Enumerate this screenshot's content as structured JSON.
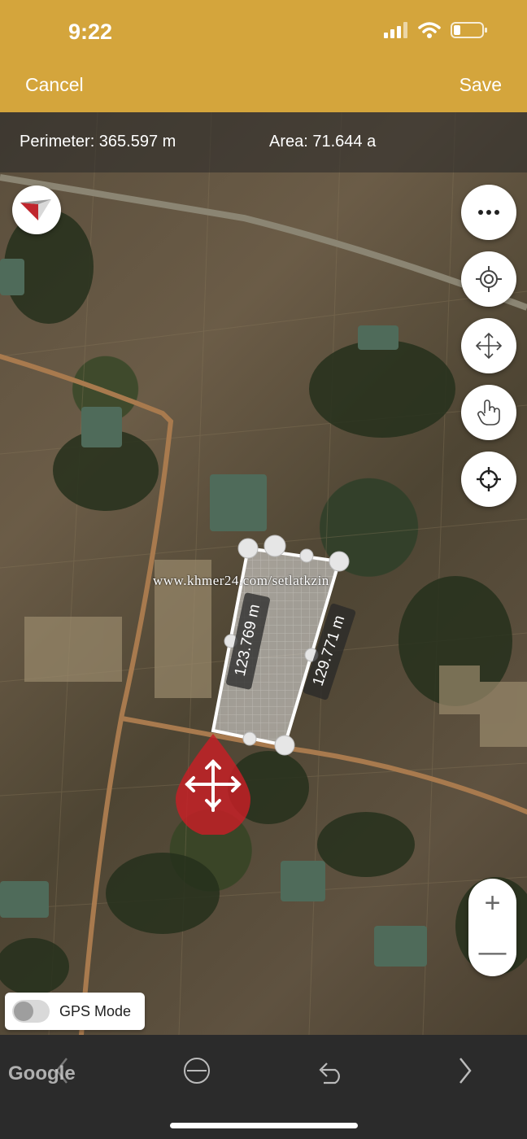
{
  "status": {
    "time": "9:22"
  },
  "nav": {
    "cancel": "Cancel",
    "save": "Save"
  },
  "info": {
    "perimeter": "Perimeter: 365.597 m",
    "area": "Area: 71.644 a"
  },
  "map": {
    "edge_left_label": "123.769 m",
    "edge_right_label": "129.771 m",
    "watermark": "www.khmer24.com/setlatkzin",
    "google": "Google"
  },
  "controls": {
    "compass": "compass-icon",
    "more": "more-icon",
    "locate": "locate-icon",
    "move": "move-icon",
    "tap": "hand-tap-icon",
    "crosshair": "crosshair-icon",
    "zoom_in": "+",
    "zoom_out": "—"
  },
  "gps": {
    "label": "GPS Mode",
    "enabled": false
  },
  "colors": {
    "accent": "#d4a53c",
    "marker": "#c0262d"
  }
}
